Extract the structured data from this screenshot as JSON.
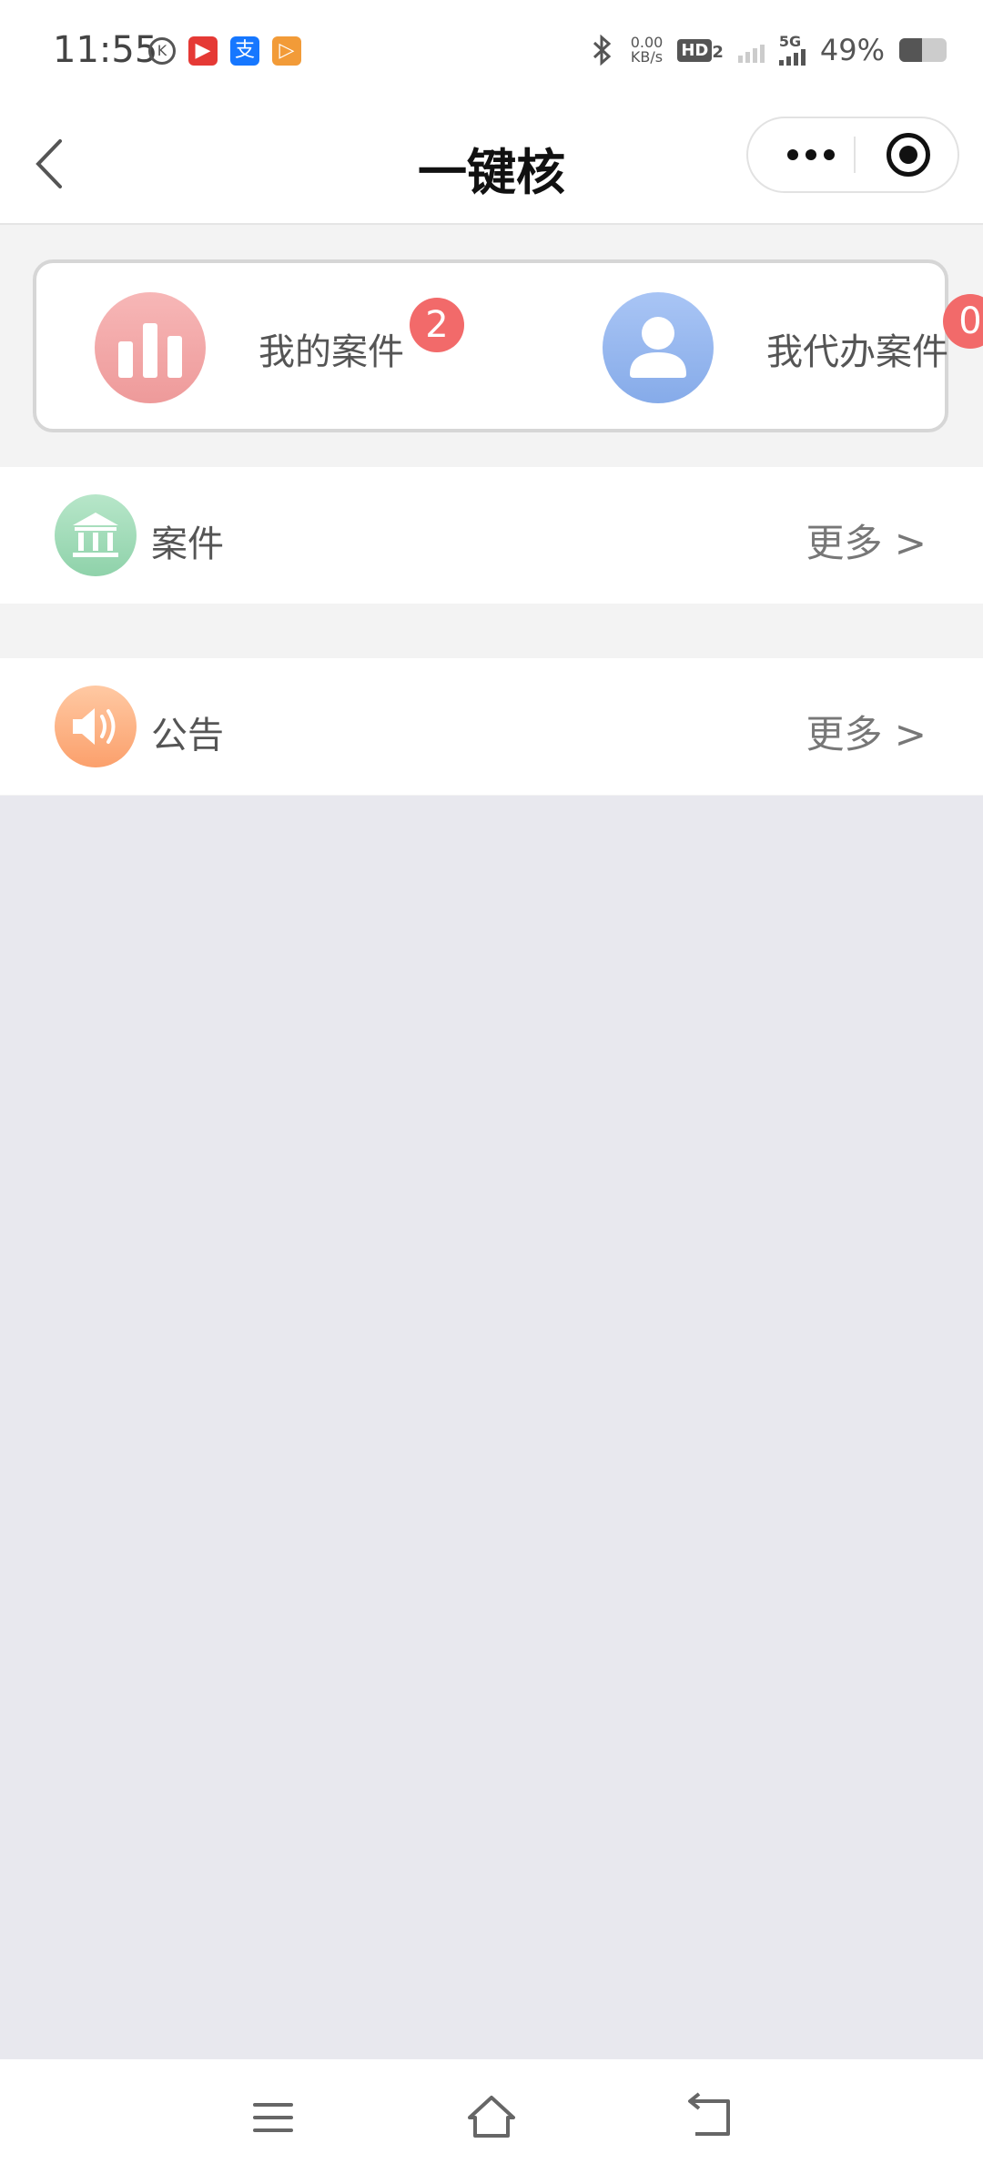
{
  "status_bar": {
    "time": "11:55",
    "net_speed_value": "0.00",
    "net_speed_unit": "KB/s",
    "hd_label": "HD",
    "hd_sub": "2",
    "network_type": "5G",
    "battery_percent": "49%",
    "battery_level": 0.49,
    "app_icons": [
      {
        "name": "k-app-icon",
        "glyph": "K"
      },
      {
        "name": "video-app-icon",
        "glyph": "▶",
        "color": "#e53935"
      },
      {
        "name": "alipay-icon",
        "glyph": "支",
        "color": "#1677ff"
      },
      {
        "name": "player-app-icon",
        "glyph": "▷",
        "color": "#f29b38"
      }
    ]
  },
  "nav": {
    "title": "一键核"
  },
  "shortcut_card": {
    "items": [
      {
        "label": "我的案件",
        "badge": "2",
        "icon": "bar-chart-icon",
        "color": "#ee9a9a"
      },
      {
        "label": "我代办案件",
        "badge": "0",
        "icon": "person-icon",
        "color": "#86abe9"
      }
    ]
  },
  "sections": [
    {
      "title": "案件",
      "more": "更多 >",
      "icon": "court-building-icon",
      "color": "#8fd2aa"
    },
    {
      "title": "公告",
      "more": "更多 >",
      "icon": "speaker-icon",
      "color": "#fba06c"
    }
  ],
  "system_nav": {
    "buttons": [
      "menu-icon",
      "home-icon",
      "back-icon"
    ]
  }
}
